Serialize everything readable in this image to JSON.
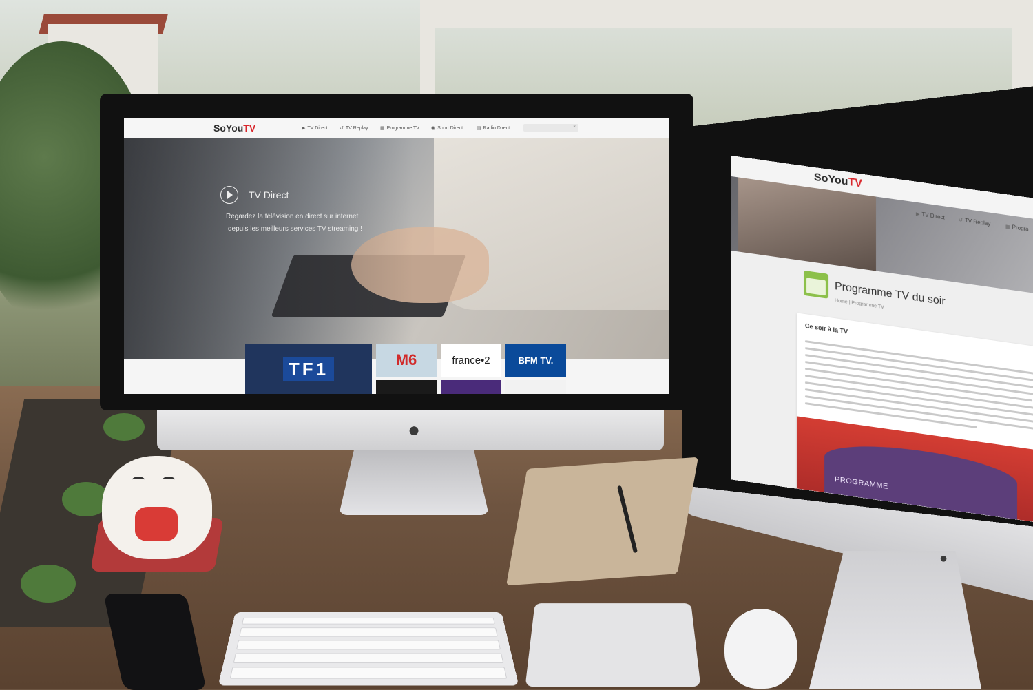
{
  "site": {
    "logo_main": "SoYou",
    "logo_accent": "TV"
  },
  "monitor1": {
    "nav": {
      "items": [
        {
          "label": "TV Direct",
          "icon": "play-icon"
        },
        {
          "label": "TV Replay",
          "icon": "replay-icon"
        },
        {
          "label": "Programme TV",
          "icon": "calendar-icon"
        },
        {
          "label": "Sport Direct",
          "icon": "ball-icon"
        },
        {
          "label": "Radio Direct",
          "icon": "radio-icon"
        }
      ],
      "search_icon": "search-icon"
    },
    "hero": {
      "title": "TV Direct",
      "line1": "Regardez la télévision en direct sur internet",
      "line2": "depuis les meilleurs services TV streaming !"
    },
    "channels": [
      {
        "label": "TF1",
        "bg": "#20355d",
        "color": "#ffffff"
      },
      {
        "label": "M6",
        "bg": "#c7d8e3",
        "color": "#d12b2b"
      },
      {
        "label": "france•2",
        "bg": "#ffffff",
        "color": "#222222"
      },
      {
        "label": "BFM TV.",
        "bg": "#0a4a9a",
        "color": "#ffffff"
      }
    ]
  },
  "monitor2": {
    "nav": {
      "items": [
        {
          "label": "TV Direct",
          "icon": "play-icon"
        },
        {
          "label": "TV Replay",
          "icon": "replay-icon"
        },
        {
          "label": "Progra",
          "icon": "calendar-icon"
        }
      ]
    },
    "page_title": "Programme TV du soir",
    "breadcrumb": {
      "home": "Home",
      "separator": "|",
      "current": "Programme TV"
    },
    "section_heading": "Ce soir à la TV",
    "promo_label": "PROGRAMME"
  },
  "colors": {
    "brand_red": "#d9262b",
    "calendar_green": "#8cc04a"
  }
}
